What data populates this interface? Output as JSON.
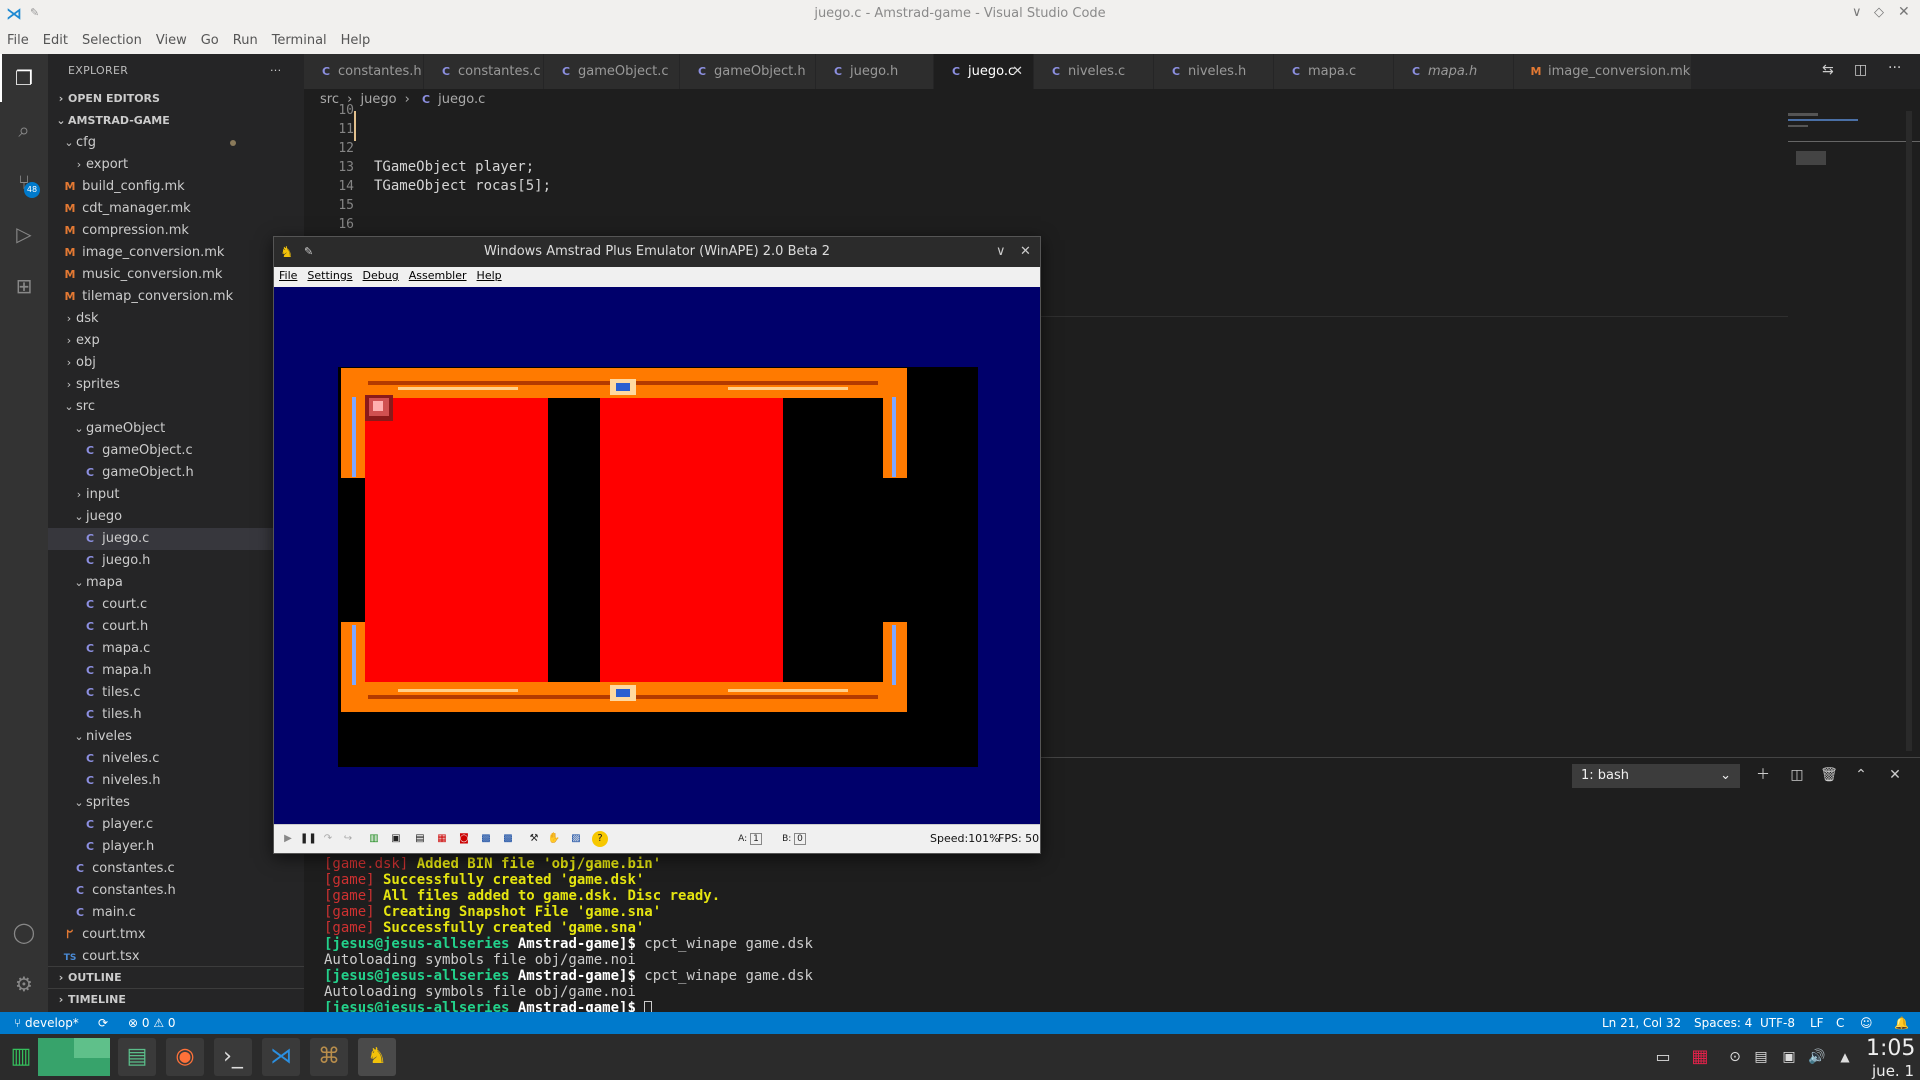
{
  "window": {
    "title": "juego.c - Amstrad-game - Visual Studio Code"
  },
  "menu": [
    "File",
    "Edit",
    "Selection",
    "View",
    "Go",
    "Run",
    "Terminal",
    "Help"
  ],
  "activity": {
    "scm_badge": "48"
  },
  "explorer": {
    "header": "EXPLORER",
    "more": "···",
    "open_editors": "OPEN EDITORS",
    "project": "AMSTRAD-GAME",
    "outline": "OUTLINE",
    "timeline": "TIMELINE",
    "tree": [
      {
        "label": "cfg",
        "kind": "folder-open",
        "depth": 1
      },
      {
        "label": "export",
        "kind": "folder",
        "depth": 2
      },
      {
        "label": "build_config.mk",
        "kind": "mk",
        "depth": 1
      },
      {
        "label": "cdt_manager.mk",
        "kind": "mk",
        "depth": 1
      },
      {
        "label": "compression.mk",
        "kind": "mk",
        "depth": 1
      },
      {
        "label": "image_conversion.mk",
        "kind": "mk",
        "depth": 1
      },
      {
        "label": "music_conversion.mk",
        "kind": "mk",
        "depth": 1
      },
      {
        "label": "tilemap_conversion.mk",
        "kind": "mk",
        "depth": 1
      },
      {
        "label": "dsk",
        "kind": "folder",
        "depth": 1
      },
      {
        "label": "exp",
        "kind": "folder",
        "depth": 1
      },
      {
        "label": "obj",
        "kind": "folder",
        "depth": 1
      },
      {
        "label": "sprites",
        "kind": "folder",
        "depth": 1
      },
      {
        "label": "src",
        "kind": "folder-open",
        "depth": 1
      },
      {
        "label": "gameObject",
        "kind": "folder-open",
        "depth": 2
      },
      {
        "label": "gameObject.c",
        "kind": "c",
        "depth": 3
      },
      {
        "label": "gameObject.h",
        "kind": "c",
        "depth": 3
      },
      {
        "label": "input",
        "kind": "folder",
        "depth": 2
      },
      {
        "label": "juego",
        "kind": "folder-open",
        "depth": 2
      },
      {
        "label": "juego.c",
        "kind": "c",
        "depth": 3,
        "selected": true
      },
      {
        "label": "juego.h",
        "kind": "c",
        "depth": 3
      },
      {
        "label": "mapa",
        "kind": "folder-open",
        "depth": 2
      },
      {
        "label": "court.c",
        "kind": "c",
        "depth": 3
      },
      {
        "label": "court.h",
        "kind": "c",
        "depth": 3
      },
      {
        "label": "mapa.c",
        "kind": "c",
        "depth": 3
      },
      {
        "label": "mapa.h",
        "kind": "c",
        "depth": 3
      },
      {
        "label": "tiles.c",
        "kind": "c",
        "depth": 3
      },
      {
        "label": "tiles.h",
        "kind": "c",
        "depth": 3
      },
      {
        "label": "niveles",
        "kind": "folder-open",
        "depth": 2
      },
      {
        "label": "niveles.c",
        "kind": "c",
        "depth": 3
      },
      {
        "label": "niveles.h",
        "kind": "c",
        "depth": 3
      },
      {
        "label": "sprites",
        "kind": "folder-open",
        "depth": 2
      },
      {
        "label": "player.c",
        "kind": "c",
        "depth": 3
      },
      {
        "label": "player.h",
        "kind": "c",
        "depth": 3
      },
      {
        "label": "constantes.c",
        "kind": "c",
        "depth": 2
      },
      {
        "label": "constantes.h",
        "kind": "c",
        "depth": 2
      },
      {
        "label": "main.c",
        "kind": "c",
        "depth": 2
      },
      {
        "label": "court.tmx",
        "kind": "tmx",
        "depth": 1
      },
      {
        "label": "court.tsx",
        "kind": "ts",
        "depth": 1
      }
    ]
  },
  "tabs": [
    {
      "label": "constantes.h",
      "icon": "C"
    },
    {
      "label": "constantes.c",
      "icon": "C"
    },
    {
      "label": "gameObject.c",
      "icon": "C"
    },
    {
      "label": "gameObject.h",
      "icon": "C"
    },
    {
      "label": "juego.h",
      "icon": "C"
    },
    {
      "label": "juego.c",
      "icon": "C",
      "active": true
    },
    {
      "label": "niveles.c",
      "icon": "C"
    },
    {
      "label": "niveles.h",
      "icon": "C"
    },
    {
      "label": "mapa.c",
      "icon": "C"
    },
    {
      "label": "mapa.h",
      "icon": "C"
    },
    {
      "label": "image_conversion.mk",
      "icon": "M"
    }
  ],
  "breadcrumb": [
    "src",
    "juego",
    "juego.c"
  ],
  "code": [
    {
      "ln": "10",
      "text": ""
    },
    {
      "ln": "11",
      "text": ""
    },
    {
      "ln": "12",
      "text": ""
    },
    {
      "ln": "13",
      "text": "TGameObject player;"
    },
    {
      "ln": "14",
      "text": "TGameObject rocas[5];"
    },
    {
      "ln": "15",
      "text": ""
    },
    {
      "ln": "16",
      "text": ""
    }
  ],
  "terminal": {
    "selector": "1: bash",
    "lines": [
      {
        "tag": "[game.dsk]",
        "msg": " Added BIN file 'obj/game.bin'",
        "style": "yel"
      },
      {
        "tag": "[game]",
        "msg": " Successfully created 'game.dsk'",
        "style": "yel"
      },
      {
        "tag": "[game]",
        "msg": " All files added to game.dsk. Disc ready.",
        "style": "yel"
      },
      {
        "tag": "[game]",
        "msg": " Creating Snapshot File 'game.sna'",
        "style": "yel"
      },
      {
        "tag": "[game]",
        "msg": " Successfully created 'game.sna'",
        "style": "yel"
      },
      {
        "prompt_user": "[jesus@jesus-allseries",
        "prompt_dir": " Amstrad-game]$",
        "cmd": " cpct_winape game.dsk"
      },
      {
        "plain": "Autoloading symbols file obj/game.noi"
      },
      {
        "prompt_user": "[jesus@jesus-allseries",
        "prompt_dir": " Amstrad-game]$",
        "cmd": " cpct_winape game.dsk"
      },
      {
        "plain": "Autoloading symbols file obj/game.noi"
      },
      {
        "prompt_user": "[jesus@jesus-allseries",
        "prompt_dir": " Amstrad-game]$",
        "cmd": " "
      }
    ]
  },
  "status": {
    "branch": "develop*",
    "errors": "0",
    "warnings": "0",
    "position": "Ln 21, Col 32",
    "spaces": "Spaces: 4",
    "encoding": "UTF-8",
    "eol": "LF",
    "language": "C"
  },
  "winape": {
    "title": "Windows Amstrad Plus Emulator (WinAPE) 2.0 Beta 2",
    "menu": [
      "File",
      "Settings",
      "Debug",
      "Assembler",
      "Help"
    ],
    "drive_a": "A:",
    "drive_a_val": "1",
    "drive_b": "B:",
    "drive_b_val": "0",
    "speed": "Speed:101%",
    "fps": "FPS: 50"
  },
  "taskbar": {
    "time": "1:05",
    "date": "jue. 1"
  },
  "colors": {
    "accent": "#007acc",
    "court": "#ff0000",
    "frame": "#ff7a00",
    "cpc_border": "#00006b"
  }
}
